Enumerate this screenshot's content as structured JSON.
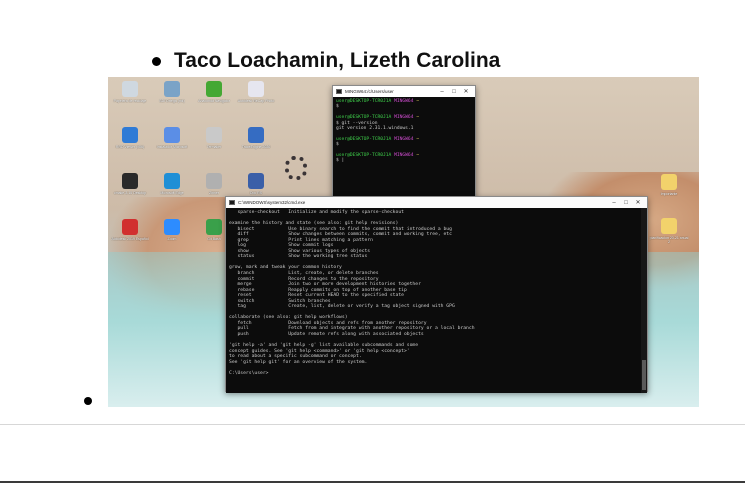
{
  "slide": {
    "heading": "Taco Loachamin, Lizeth Carolina"
  },
  "desktop": {
    "icons_left": [
      {
        "label": "Papelera de reciclaje",
        "color": "#cfd8e0"
      },
      {
        "label": "SDI Ortega (mk)",
        "color": "#7aa3c7"
      },
      {
        "label": "Anaconda Navigator",
        "color": "#44a833"
      },
      {
        "label": "Autodesk ReCap Photo",
        "color": "#e6e6f0"
      },
      {
        "label": "RRD Viewer (x86)",
        "color": "#2f7bd6"
      },
      {
        "label": "Instalador Microsoft",
        "color": "#5b8ee6"
      },
      {
        "label": "Termaker",
        "color": "#c9c9c9"
      },
      {
        "label": "TraceEngine 2020",
        "color": "#356cc2"
      },
      {
        "label": "cmake-3.15 Desktop",
        "color": "#2a2a2a"
      },
      {
        "label": "Microsoft Edge",
        "color": "#1f8fd6"
      },
      {
        "label": "Zinner",
        "color": "#b0b0b0"
      },
      {
        "label": "Doc RS",
        "color": "#3a5fa8"
      },
      {
        "label": "Autodesk 2019 Español",
        "color": "#d12f2f"
      },
      {
        "label": "Zoom",
        "color": "#2d8cff"
      },
      {
        "label": "Git Bash",
        "color": "#3aa04a"
      },
      {
        "label": "Avast Free Antivirus",
        "color": "#f07a1a"
      }
    ],
    "icons_right": [
      {
        "label": "Importante",
        "color": "#f2d26b"
      },
      {
        "label": "planificacion 20-21 anual 2",
        "color": "#f2d26b"
      }
    ]
  },
  "git_window": {
    "title": "MINGW64:/c/Users/user",
    "lines": [
      {
        "p": "user@DESKTOP-TCR0J1A",
        "m": "MINGW64",
        "y": "~",
        "t": ""
      },
      {
        "p": "",
        "m": "",
        "y": "",
        "t": "$"
      },
      {
        "p": "",
        "m": "",
        "y": "",
        "t": ""
      },
      {
        "p": "user@DESKTOP-TCR0J1A",
        "m": "MINGW64",
        "y": "~",
        "t": ""
      },
      {
        "p": "",
        "m": "",
        "y": "",
        "t": "$ git --version"
      },
      {
        "p": "",
        "m": "",
        "y": "",
        "t": "git version 2.31.1.windows.1"
      },
      {
        "p": "",
        "m": "",
        "y": "",
        "t": ""
      },
      {
        "p": "user@DESKTOP-TCR0J1A",
        "m": "MINGW64",
        "y": "~",
        "t": ""
      },
      {
        "p": "",
        "m": "",
        "y": "",
        "t": "$"
      },
      {
        "p": "",
        "m": "",
        "y": "",
        "t": ""
      },
      {
        "p": "user@DESKTOP-TCR0J1A",
        "m": "MINGW64",
        "y": "~",
        "t": ""
      },
      {
        "p": "",
        "m": "",
        "y": "",
        "t": "$ |"
      }
    ]
  },
  "cmd_window": {
    "title": "C:\\WINDOWS\\system32\\cmd.exe",
    "text": "   sparse-checkout   Initialize and modify the sparse-checkout\n\nexamine the history and state (see also: git help revisions)\n   bisect            Use binary search to find the commit that introduced a bug\n   diff              Show changes between commits, commit and working tree, etc\n   grep              Print lines matching a pattern\n   log               Show commit logs\n   show              Show various types of objects\n   status            Show the working tree status\n\ngrow, mark and tweak your common history\n   branch            List, create, or delete branches\n   commit            Record changes to the repository\n   merge             Join two or more development histories together\n   rebase            Reapply commits on top of another base tip\n   reset             Reset current HEAD to the specified state\n   switch            Switch branches\n   tag               Create, list, delete or verify a tag object signed with GPG\n\ncollaborate (see also: git help workflows)\n   fetch             Download objects and refs from another repository\n   pull              Fetch from and integrate with another repository or a local branch\n   push              Update remote refs along with associated objects\n\n'git help -a' and 'git help -g' list available subcommands and some\nconcept guides. See 'git help <command>' or 'git help <concept>'\nto read about a specific subcommand or concept.\nSee 'git help git' for an overview of the system.\n\nC:\\Users\\user>"
  },
  "window_controls": {
    "minimize": "–",
    "maximize": "□",
    "close": "✕"
  }
}
